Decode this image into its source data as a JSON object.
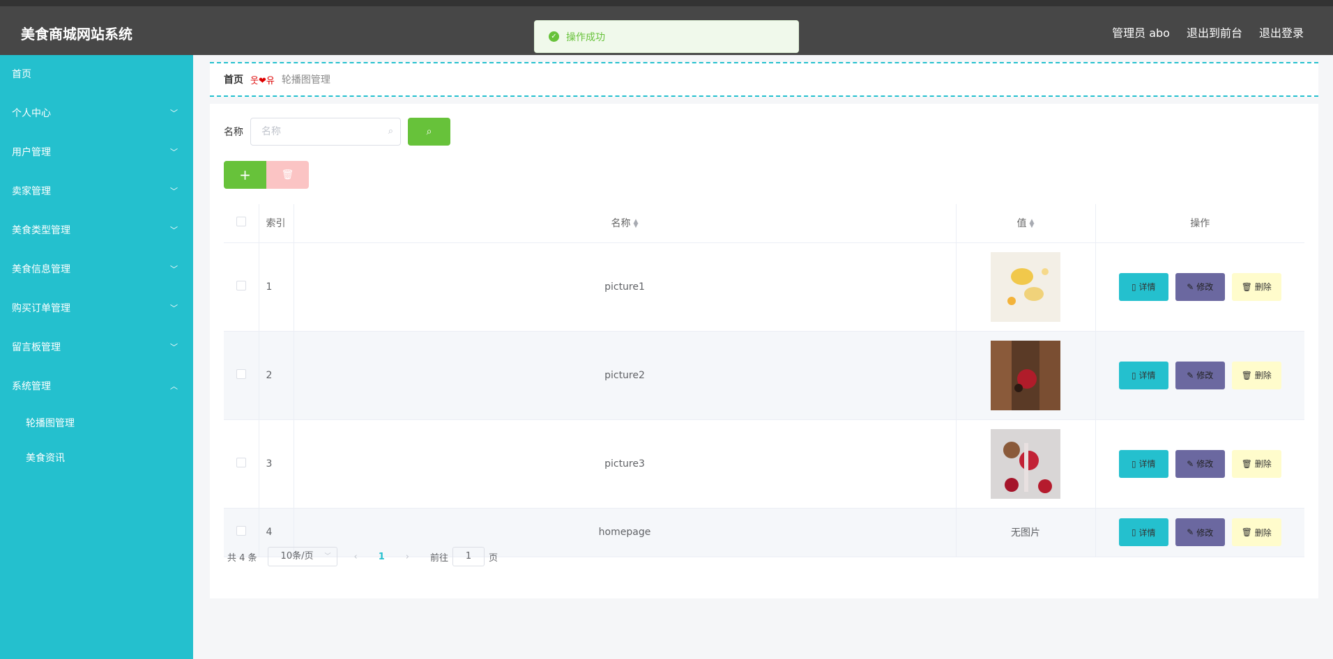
{
  "header": {
    "brand": "美食商城网站系统",
    "admin": "管理员 abo",
    "to_front": "退出到前台",
    "logout": "退出登录"
  },
  "toast": {
    "message": "操作成功"
  },
  "sidebar": {
    "items": [
      {
        "label": "首页"
      },
      {
        "label": "个人中心"
      },
      {
        "label": "用户管理"
      },
      {
        "label": "卖家管理"
      },
      {
        "label": "美食类型管理"
      },
      {
        "label": "美食信息管理"
      },
      {
        "label": "购买订单管理"
      },
      {
        "label": "留言板管理"
      },
      {
        "label": "系统管理"
      }
    ],
    "sub_items": [
      {
        "label": "轮播图管理"
      },
      {
        "label": "美食资讯"
      }
    ]
  },
  "breadcrumb": {
    "home": "首页",
    "sep": "웃❤유",
    "current": "轮播图管理"
  },
  "search": {
    "label": "名称",
    "placeholder": "名称"
  },
  "table": {
    "headers": {
      "index": "索引",
      "name": "名称",
      "value": "值",
      "ops": "操作"
    },
    "rows": [
      {
        "index": "1",
        "name": "picture1",
        "value": "",
        "thumb": "gold"
      },
      {
        "index": "2",
        "name": "picture2",
        "value": "",
        "thumb": "brown"
      },
      {
        "index": "3",
        "name": "picture3",
        "value": "",
        "thumb": "red"
      },
      {
        "index": "4",
        "name": "homepage",
        "value": "无图片",
        "thumb": ""
      }
    ],
    "op_labels": {
      "detail": "详情",
      "edit": "修改",
      "delete": "删除"
    }
  },
  "pager": {
    "total": "共 4 条",
    "page_size": "10条/页",
    "current": "1",
    "goto_prefix": "前往",
    "goto_value": "1",
    "goto_suffix": "页"
  },
  "colors": {
    "sidebar": "#24c0ce",
    "topbar": "#474747",
    "success": "#67c23a",
    "edit": "#6b68a0",
    "delete_bg": "#fffccc"
  }
}
